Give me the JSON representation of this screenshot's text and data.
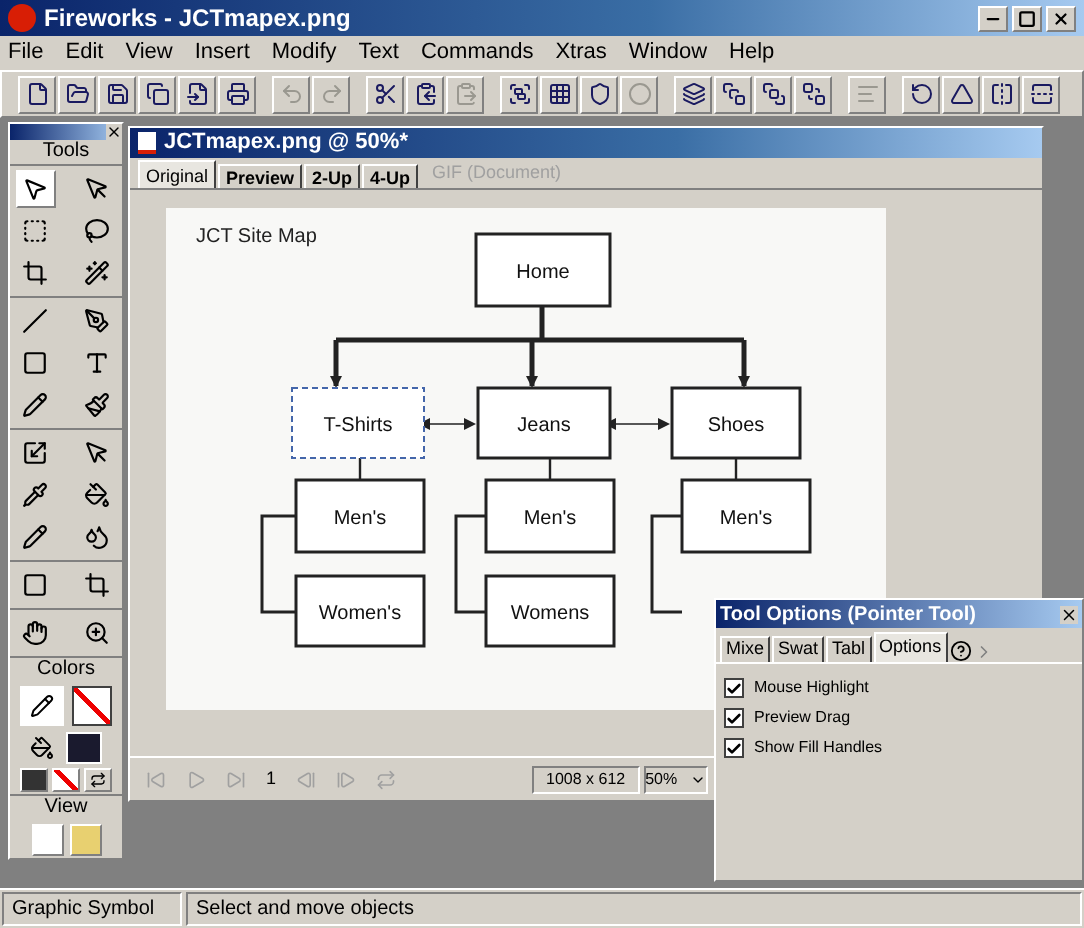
{
  "window": {
    "title": "Fireworks - JCTmapex.png"
  },
  "menu": [
    "File",
    "Edit",
    "View",
    "Insert",
    "Modify",
    "Text",
    "Commands",
    "Xtras",
    "Window",
    "Help"
  ],
  "toolbar": [
    {
      "disabled": false
    },
    {
      "disabled": false
    },
    {
      "disabled": false
    },
    {
      "disabled": false
    },
    {
      "disabled": false
    },
    {
      "disabled": false
    },
    {
      "disabled": true
    },
    {
      "disabled": true
    },
    {
      "disabled": false
    },
    {
      "disabled": false
    },
    {
      "disabled": true
    },
    {
      "disabled": false
    },
    {
      "disabled": false
    },
    {
      "disabled": false
    },
    {
      "disabled": true
    },
    {
      "disabled": false
    },
    {
      "disabled": false
    },
    {
      "disabled": false
    },
    {
      "disabled": false
    },
    {
      "disabled": true
    },
    {
      "disabled": false
    },
    {
      "disabled": false
    },
    {
      "disabled": false
    },
    {
      "disabled": false
    }
  ],
  "tools_panel": {
    "title": "Tools",
    "colors_title": "Colors",
    "view_title": "View"
  },
  "document": {
    "title": "JCTmapex.png @ 50%*",
    "tabs": [
      {
        "label": "Original",
        "selected": true
      },
      {
        "label": "Preview",
        "selected": false
      },
      {
        "label": "2-Up",
        "selected": false
      },
      {
        "label": "4-Up",
        "selected": false
      }
    ],
    "format_label": "GIF (Document)",
    "canvas_title": "JCT Site Map",
    "nodes": [
      {
        "label": "Home",
        "selected": false
      },
      {
        "label": "T-Shirts",
        "selected": true
      },
      {
        "label": "Jeans",
        "selected": false
      },
      {
        "label": "Shoes",
        "selected": false
      },
      {
        "label": "Men's",
        "selected": false
      },
      {
        "label": "Men's",
        "selected": false
      },
      {
        "label": "Men's",
        "selected": false
      },
      {
        "label": "Women's",
        "selected": false
      },
      {
        "label": "Womens",
        "selected": false
      }
    ],
    "frame": "1",
    "size": "1008 x 612",
    "zoom": "50%"
  },
  "tool_options": {
    "title": "Tool Options (Pointer Tool)",
    "tabs": [
      {
        "label": "Mixe",
        "selected": false
      },
      {
        "label": "Swat",
        "selected": false
      },
      {
        "label": "Tabl",
        "selected": false
      },
      {
        "label": "Options",
        "selected": true
      }
    ],
    "options": [
      {
        "label": "Mouse Highlight",
        "checked": true
      },
      {
        "label": "Preview Drag",
        "checked": true
      },
      {
        "label": "Show Fill Handles",
        "checked": true
      }
    ]
  },
  "status_bar": {
    "object": "Graphic Symbol",
    "hint": "Select and move objects"
  }
}
